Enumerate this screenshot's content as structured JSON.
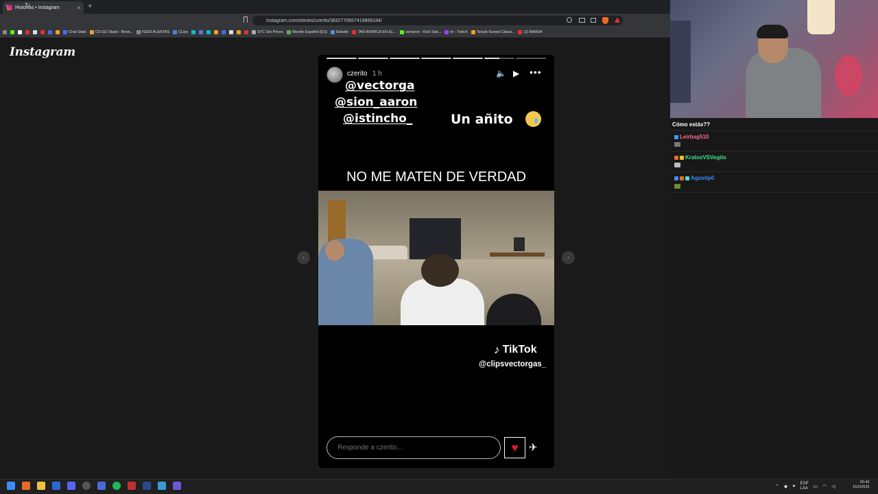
{
  "browser": {
    "tab_title": "Historias • Instagram",
    "tab_close": "×",
    "new_tab": "+",
    "url": "instagram.com/stories/czerito/3832770657419899184/",
    "nav_back": "‹",
    "nav_forward": "›",
    "nav_reload": "↻"
  },
  "bookmarks": [
    {
      "label": "Chat Stats",
      "color": "#4b6cff"
    },
    {
      "label": "CS:GO Stash - Brow...",
      "color": "#e8a33a"
    },
    {
      "label": "FEED ALERTAS",
      "color": "#888"
    },
    {
      "label": "CLips",
      "color": "#5a7bd8"
    },
    {
      "label": "STC Set Prices",
      "color": "#aaa"
    },
    {
      "label": "Wordle Español (ES)",
      "color": "#6aaa64"
    },
    {
      "label": "Boludle",
      "color": "#4a90e2"
    },
    {
      "label": "TAN BIONICA EN EL...",
      "color": "#e03030"
    },
    {
      "label": "sionaron - Kick Stat...",
      "color": "#53fc18"
    },
    {
      "label": "trr - Twitch",
      "color": "#9146ff"
    },
    {
      "label": "Tanuki Sunset Classi...",
      "color": "#f0a020"
    },
    {
      "label": "(2) BARRA",
      "color": "#e03030"
    }
  ],
  "instagram": {
    "logo": "Instagram",
    "story": {
      "username": "czerito",
      "time": "1 h",
      "mute_icon": "🔈",
      "play_icon": "▶",
      "more_icon": "•••",
      "tags": [
        "@vectorga",
        "@sion_aaron",
        "@istincho_"
      ],
      "caption_right": "Un añito",
      "headline": "NO ME MATEN DE VERDAD",
      "tiktok_label": "TikTok",
      "tiktok_user": "@clipsvectorgas_",
      "progress_segments": 7,
      "progress_current_index": 5,
      "progress_current_fraction": 0.5
    },
    "reply_placeholder": "Responde a czerito...",
    "like_icon": "♥",
    "send_icon": "✈",
    "prev_icon": "‹",
    "next_icon": "›"
  },
  "stream_chat": {
    "prompt": "Cómo estás??",
    "messages": [
      {
        "user": "Leirbag510",
        "color": "#ff6b8a"
      },
      {
        "user": "KratosVSVegito",
        "color": "#3ee38a"
      },
      {
        "user": "Agustip0",
        "color": "#3c8dff"
      }
    ]
  },
  "taskbar": {
    "tray_lang": "ESP",
    "tray_lang2": "LAA",
    "time": "00:43",
    "date": "15/2/2026"
  }
}
